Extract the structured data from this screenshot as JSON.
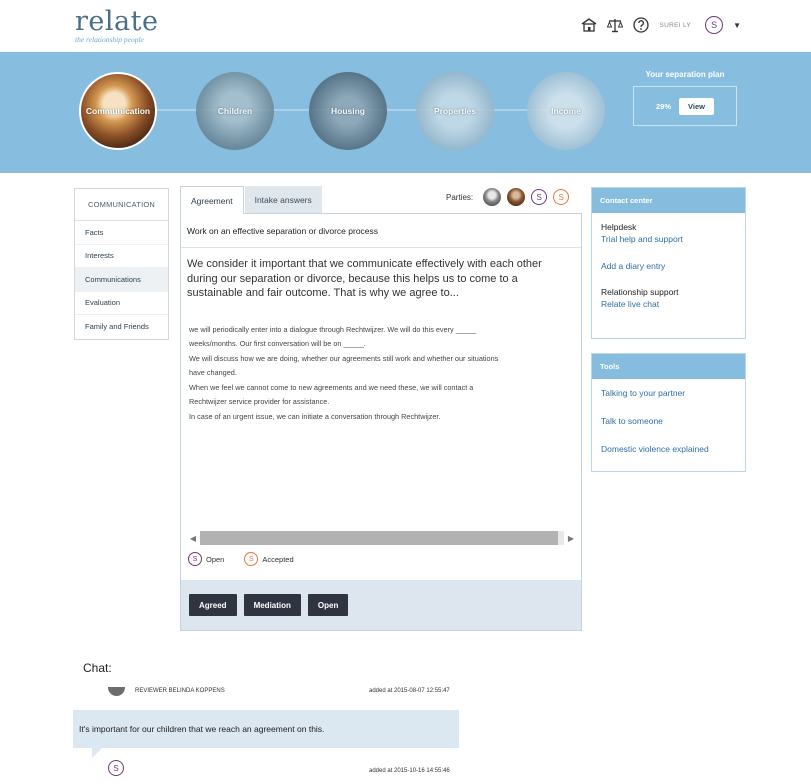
{
  "header": {
    "logo": "relate",
    "tagline": "the relationship people",
    "user_name": "SUREI LY",
    "avatar_letter": "S",
    "icons": [
      "home-icon",
      "scales-icon",
      "help-icon"
    ]
  },
  "hero": {
    "steps": [
      {
        "label": "Communication"
      },
      {
        "label": "Children"
      },
      {
        "label": "Housing"
      },
      {
        "label": "Properties"
      },
      {
        "label": "Income"
      }
    ],
    "plan_title": "Your separation plan",
    "plan_percent": "29%",
    "plan_view": "View"
  },
  "leftnav": {
    "title": "COMMUNICATION",
    "items": [
      {
        "label": "Facts"
      },
      {
        "label": "Interests"
      },
      {
        "label": "Communications"
      },
      {
        "label": "Evaluation"
      },
      {
        "label": "Family and Friends"
      }
    ]
  },
  "tabs": {
    "agreement": "Agreement",
    "intake": "Intake answers"
  },
  "parties": {
    "label": "Parties:",
    "letter_purple": "S",
    "letter_orange": "S"
  },
  "panel": {
    "heading": "Work on an effective separation or divorce process",
    "intro": "We consider it important that we communicate effectively with each other during our separation or divorce, because this helps us to come to a sustainable and fair outcome. That is why we agree to...",
    "lines": [
      "we will periodically enter into a dialogue through Rechtwijzer. We will do this every _____",
      "weeks/months. Our first conversation will be on _____.",
      "We will discuss how we are doing, whether our agreements still work and whether our situations",
      "have changed.",
      "When we feel we cannot come to new agreements and we need these, we will contact a",
      "Rechtwijzer service provider for assistance.",
      "In case of an urgent issue, we can initiate a conversation through Rechtwijzer."
    ],
    "legend": {
      "open_letter": "S",
      "open_label": "Open",
      "accepted_letter": "S",
      "accepted_label": "Accepted"
    },
    "buttons": {
      "agreed": "Agreed",
      "mediation": "Mediation",
      "open": "Open"
    }
  },
  "contact": {
    "title": "Contact center",
    "helpdesk": "Helpdesk",
    "trial_help": "Trial help and support",
    "diary": "Add a diary entry",
    "relationship": "Relationship support",
    "live_chat": "Relate live chat"
  },
  "tools": {
    "title": "Tools",
    "items": [
      {
        "label": "Talking to your partner"
      },
      {
        "label": "Talk to someone"
      },
      {
        "label": "Domestic violence explained"
      }
    ]
  },
  "chat": {
    "title": "Chat:",
    "first_author": "REVIEWER BELINDA KOPPENS",
    "first_added": "added at 2015-08-07 12:55:47",
    "message": "It's important for our children that we reach an agreement on this.",
    "second_letter": "S",
    "second_added": "added at 2015-10-16 14:55:46"
  },
  "colors": {
    "hero": "#87bdde",
    "accent_purple": "#6b3a7a",
    "accent_orange": "#e07b39",
    "link": "#2f6fa5",
    "button_dark": "#2f3440"
  }
}
